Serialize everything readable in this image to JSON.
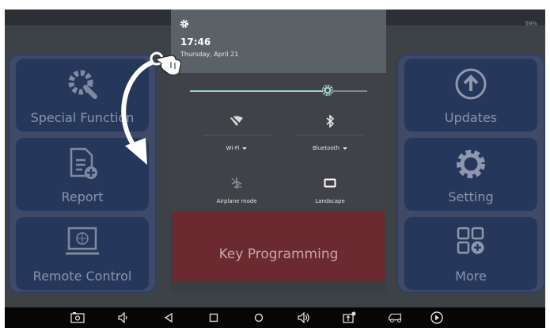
{
  "status_bar": {
    "battery_text": "59%"
  },
  "notification_shade": {
    "time": "17:46",
    "date": "Thursday, April 21",
    "brightness_level": 0.78,
    "tiles": [
      {
        "label": "Wi-Fi",
        "icon": "wifi-off-icon",
        "has_dropdown": true
      },
      {
        "label": "Bluetooth",
        "icon": "bluetooth-icon",
        "has_dropdown": true
      },
      {
        "label": "Airplane mode",
        "icon": "airplane-icon",
        "has_dropdown": false
      },
      {
        "label": "Landscape",
        "icon": "landscape-icon",
        "has_dropdown": false
      }
    ]
  },
  "left_menu": {
    "items": [
      {
        "label": "Special Function",
        "icon": "wrench-gear-icon"
      },
      {
        "label": "Report",
        "icon": "report-icon"
      },
      {
        "label": "Remote Control",
        "icon": "remote-globe-icon"
      }
    ]
  },
  "right_menu": {
    "items": [
      {
        "label": "Updates",
        "icon": "upload-arrow-icon"
      },
      {
        "label": "Setting",
        "icon": "gear-icon"
      },
      {
        "label": "More",
        "icon": "grid-plus-icon"
      }
    ]
  },
  "center": {
    "key_programming_label": "Key Programming"
  },
  "colors": {
    "panel_blue": "#26375c",
    "key_red": "#6a2a30",
    "slider_accent": "#9ed3ce",
    "shade_bg": "#5b6267"
  }
}
